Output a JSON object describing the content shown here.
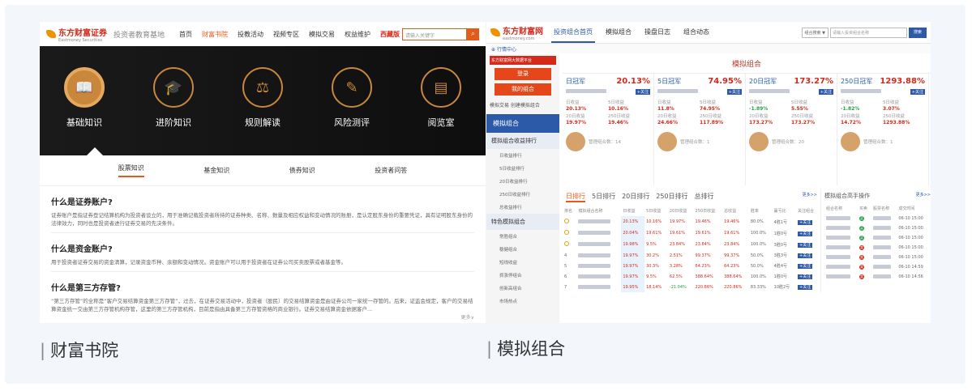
{
  "left": {
    "brand": "东方财富证券",
    "brand_en": "Eastmoney Securities",
    "subtitle": "投资者教育基地",
    "nav": [
      "首页",
      "财富书院",
      "投教活动",
      "视频专区",
      "模拟交易",
      "权益维护",
      "西藏版"
    ],
    "nav_active_index": 1,
    "search_placeholder": "请输入关键字",
    "hero_items": [
      "基础知识",
      "进阶知识",
      "规则解读",
      "风险测评",
      "阅览室"
    ],
    "hero_icons": [
      "book-icon",
      "graduation-cap-icon",
      "rules-icon",
      "edit-icon",
      "reader-icon"
    ],
    "sub_tabs": [
      "股票知识",
      "基金知识",
      "债券知识",
      "投资者问答"
    ],
    "qa": [
      {
        "q": "什么是证券账户?",
        "a": "证券账户是指证券登记结算机构为投资者设立的，用于准确记载投资者所持的证券种类、名称、数量及相应权益和变动情况的账册，是认定股东身份的重要凭证，具有证明股东身份的法律效力，同时也是投资者进行证券交易的先决条件。"
      },
      {
        "q": "什么是资金账户?",
        "a": "用于投资者证券交易的资金清算，记录资金币种、余额和变动情况。资金账户可以用于投资者在证券公司买卖股票或者基金等。"
      },
      {
        "q": "什么是第三方存管?",
        "a": "“第三方存管”的全称是“客户交易结算资金第三方存管”，过去，在证券交易活动中，投资者（股民）的交易结算资金是由证券公司一家统一存管的。后来，证监会规定，客户的交易结算资金统一交由第三方存管机构存管，这里的第三方存管机构，目前是指由具备第三方存管资格的商业银行。证券交易结算资金依据客户..."
      }
    ],
    "more_label": "更多∨",
    "caption": "财富书院"
  },
  "right": {
    "brand": "东方财富网",
    "brand_en": "eastmoney.com",
    "tabs": [
      "投资组合首页",
      "模拟组合",
      "操盘日志",
      "组合动态"
    ],
    "search_type": "组合搜索 ▼",
    "search_placeholder": "请输入投资组合名称",
    "search_btn": "搜索",
    "quote_center": "行情中心",
    "side": {
      "banner": "东方财富网大数据平台",
      "btn_login": "登录",
      "btn_my": "我的组合",
      "links": "模拟交易  创建模拟组合",
      "section1": "模拟组合",
      "group1": "模拟组合收益排行",
      "group1_items": [
        "日收益排行",
        "5日收益排行",
        "20日收益排行",
        "250日收益排行",
        "总收益排行"
      ],
      "group2": "特色模拟组合",
      "group2_items": [
        "常胜组合",
        "稳健组合",
        "短线收益",
        "抓涨停组合",
        "创新高组合",
        "市场热点"
      ]
    },
    "section_title": "模拟组合",
    "cards": [
      {
        "name": "日冠军",
        "pct": "20.13%",
        "labels": [
          "日收益",
          "5日收益",
          "20日收益",
          "250日收益"
        ],
        "vals": [
          "20.13%",
          "10.16%",
          "19.97%",
          "19.46%"
        ],
        "mgr": "管理组合数：14"
      },
      {
        "name": "5日冠军",
        "pct": "74.95%",
        "labels": [
          "日收益",
          "5日收益",
          "20日收益",
          "250日收益"
        ],
        "vals": [
          "11.8%",
          "74.95%",
          "24.66%",
          "117.89%"
        ],
        "mgr": "管理组合数：1"
      },
      {
        "name": "20日冠军",
        "pct": "173.27%",
        "labels": [
          "日收益",
          "5日收益",
          "20日收益",
          "250日收益"
        ],
        "vals": [
          "-1.89%",
          "5.55%",
          "173.27%",
          "173.27%"
        ],
        "mgr": "管理组合数：20"
      },
      {
        "name": "250日冠军",
        "pct": "1293.88%",
        "labels": [
          "日收益",
          "5日收益",
          "20日收益",
          "250日收益"
        ],
        "vals": [
          "-1.82%",
          "3.07%",
          "14.72%",
          "1293.88%"
        ],
        "mgr": "管理组合数：1"
      }
    ],
    "follow": "+关注",
    "rank_tabs": [
      "日排行",
      "5日排行",
      "20日排行",
      "250日排行",
      "总排行"
    ],
    "more": "更多>>",
    "rank_headers": [
      "排名",
      "模拟组合名称",
      "日收益",
      "5日收益",
      "20日收益",
      "250日收益",
      "总收益",
      "胜率",
      "赢亏比",
      "关注组合"
    ],
    "rank_rows": [
      [
        "1",
        "",
        "20.13%",
        "10.16%",
        "19.97%",
        "19.46%",
        "19.46%",
        "80.0%",
        "4胜1亏"
      ],
      [
        "2",
        "",
        "20.04%",
        "19.61%",
        "19.61%",
        "19.61%",
        "19.61%",
        "100.0%",
        "1胜0亏"
      ],
      [
        "3",
        "",
        "19.98%",
        "9.5%",
        "23.84%",
        "23.84%",
        "23.84%",
        "100.0%",
        "3胜0亏"
      ],
      [
        "4",
        "",
        "19.97%",
        "30.2%",
        "2.51%",
        "99.37%",
        "99.37%",
        "50.0%",
        "3胜3亏"
      ],
      [
        "5",
        "",
        "19.97%",
        "30.3%",
        "3.28%",
        "64.23%",
        "64.23%",
        "50.0%",
        "4胜4亏"
      ],
      [
        "6",
        "",
        "19.97%",
        "9.5%",
        "62.5%",
        "388.64%",
        "388.64%",
        "100.0%",
        "1胜0亏"
      ],
      [
        "7",
        "",
        "19.95%",
        "18.14%",
        "-21.04%",
        "220.86%",
        "220.86%",
        "83.33%",
        "10胜2亏"
      ]
    ],
    "ops_title": "模拟组合高手操作",
    "ops_headers": [
      "组合名称",
      "买卖",
      "股票名称",
      "成交时间"
    ],
    "ops_rows": [
      [
        "买",
        "06-10 15:00"
      ],
      [
        "买",
        "06-10 15:00"
      ],
      [
        "买",
        "06-10 15:00"
      ],
      [
        "卖",
        "06-10 15:00"
      ],
      [
        "卖",
        "06-10 15:00"
      ],
      [
        "卖",
        "06-10 14:59"
      ],
      [
        "卖",
        "06-10 14:56"
      ]
    ],
    "caption": "模拟组合"
  }
}
